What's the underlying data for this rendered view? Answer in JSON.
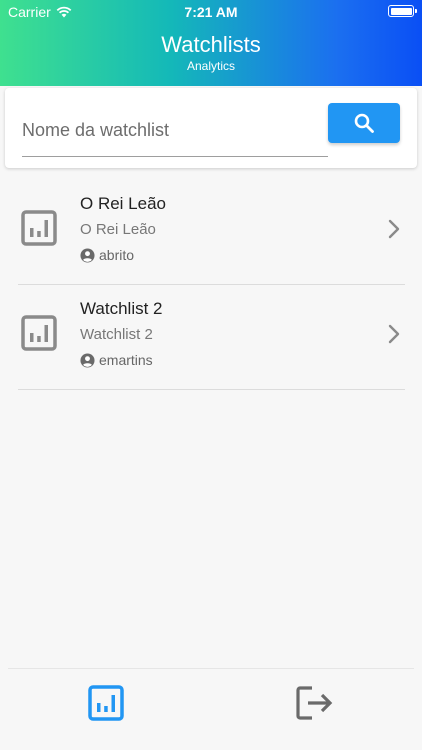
{
  "status_bar": {
    "carrier": "Carrier",
    "time": "7:21 AM"
  },
  "header": {
    "title": "Watchlists",
    "subtitle": "Analytics"
  },
  "search": {
    "placeholder": "Nome da watchlist",
    "value": ""
  },
  "watchlists": [
    {
      "title": "O Rei Leão",
      "subtitle": "O Rei Leão",
      "user": "abrito"
    },
    {
      "title": "Watchlist 2",
      "subtitle": "Watchlist 2",
      "user": "emartins"
    }
  ],
  "colors": {
    "accent": "#2196f3",
    "header_start": "#3fe08f",
    "header_end": "#0a4ff5",
    "icon_gray": "#8a8a8a"
  },
  "bottom_nav": {
    "items": [
      {
        "icon": "analytics-icon",
        "active": true
      },
      {
        "icon": "logout-icon",
        "active": false
      }
    ]
  }
}
